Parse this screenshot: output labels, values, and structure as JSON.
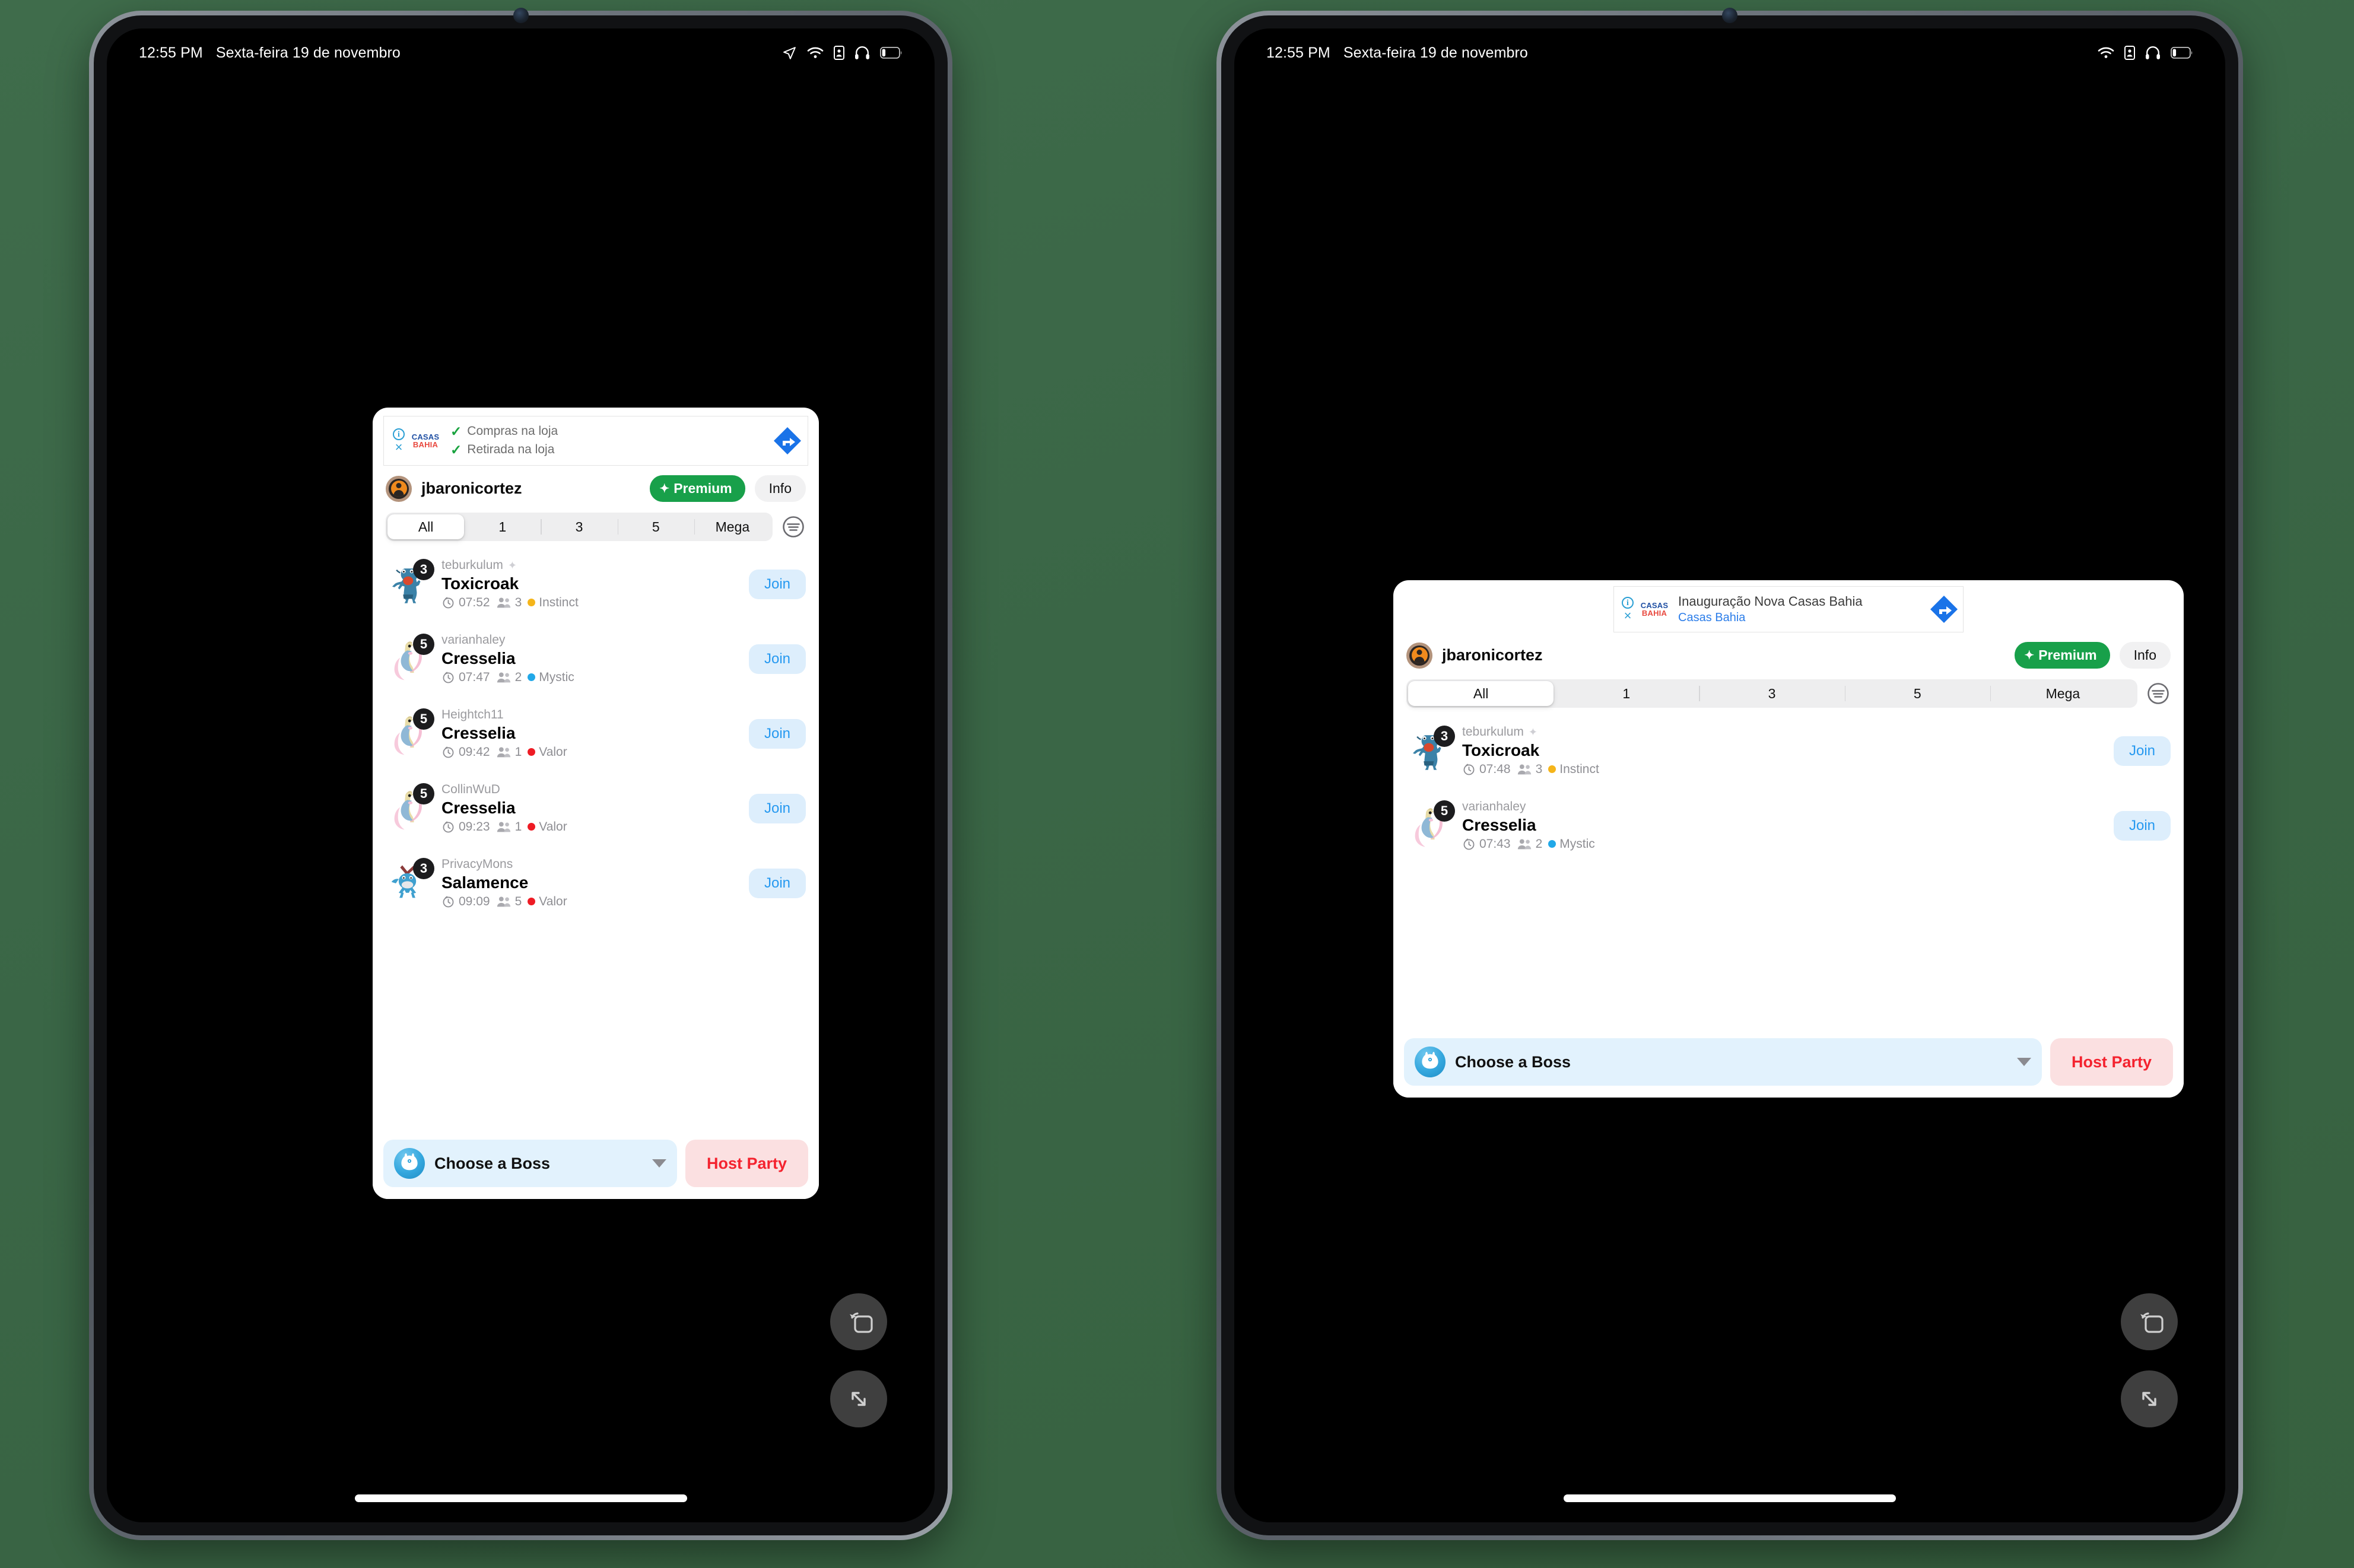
{
  "background_color": "#3e6b4a",
  "status_bar": {
    "time": "12:55 PM",
    "date": "Sexta-feira 19 de novembro",
    "icons_left_device": [
      "location-arrow-icon",
      "wifi-icon",
      "screen-lock-icon",
      "headphones-icon",
      "battery-icon"
    ],
    "icons_right_device": [
      "wifi-icon",
      "screen-lock-icon",
      "headphones-icon",
      "battery-icon"
    ]
  },
  "app": {
    "ad_left": {
      "brand_line1": "CASAS",
      "brand_line2": "BAHIA",
      "bullet1": "Compras na loja",
      "bullet2": "Retirada na loja",
      "info_glyph": "i",
      "close_glyph": "×",
      "arrow_icon": "ad-choices-arrow-icon"
    },
    "ad_right": {
      "brand_line1": "CASAS",
      "brand_line2": "BAHIA",
      "title": "Inauguração Nova Casas Bahia",
      "subtitle": "Casas Bahia",
      "info_glyph": "i",
      "close_glyph": "×",
      "arrow_icon": "ad-choices-arrow-icon"
    },
    "header": {
      "username": "jbaronicortez",
      "premium_label": "Premium",
      "premium_color": "#18a04a",
      "info_label": "Info",
      "avatar_icon": "user-avatar-icon"
    },
    "segments": [
      {
        "label": "All",
        "selected": true
      },
      {
        "label": "1",
        "selected": false
      },
      {
        "label": "3",
        "selected": false
      },
      {
        "label": "5",
        "selected": false
      },
      {
        "label": "Mega",
        "selected": false
      }
    ],
    "filter_icon": "filter-sort-icon",
    "join_label": "Join",
    "rows_left": [
      {
        "host": "teburkulum",
        "shiny": true,
        "boss": "Toxicroak",
        "level": "3",
        "time": "07:52",
        "players": "3",
        "team": "Instinct",
        "team_color": "#f5b51a",
        "sprite": "toxicroak"
      },
      {
        "host": "varianhaley",
        "shiny": false,
        "boss": "Cresselia",
        "level": "5",
        "time": "07:47",
        "players": "2",
        "team": "Mystic",
        "team_color": "#21a8e8",
        "sprite": "cresselia"
      },
      {
        "host": "Heightch11",
        "shiny": false,
        "boss": "Cresselia",
        "level": "5",
        "time": "09:42",
        "players": "1",
        "team": "Valor",
        "team_color": "#ee1b24",
        "sprite": "cresselia"
      },
      {
        "host": "CollinWuD",
        "shiny": false,
        "boss": "Cresselia",
        "level": "5",
        "time": "09:23",
        "players": "1",
        "team": "Valor",
        "team_color": "#ee1b24",
        "sprite": "cresselia"
      },
      {
        "host": "PrivacyMons",
        "shiny": false,
        "boss": "Salamence",
        "level": "3",
        "time": "09:09",
        "players": "5",
        "team": "Valor",
        "team_color": "#ee1b24",
        "sprite": "salamence"
      }
    ],
    "rows_right": [
      {
        "host": "teburkulum",
        "shiny": true,
        "boss": "Toxicroak",
        "level": "3",
        "time": "07:48",
        "players": "3",
        "team": "Instinct",
        "team_color": "#f5b51a",
        "sprite": "toxicroak"
      },
      {
        "host": "varianhaley",
        "shiny": false,
        "boss": "Cresselia",
        "level": "5",
        "time": "07:43",
        "players": "2",
        "team": "Mystic",
        "team_color": "#21a8e8",
        "sprite": "cresselia"
      }
    ],
    "bottom_bar": {
      "choose_label": "Choose a Boss",
      "choose_icon": "pokemon-boss-icon",
      "dropdown_icon": "caret-down-icon",
      "host_label": "Host Party",
      "host_color": "#f4232f"
    }
  },
  "overlay_buttons": {
    "rotate_icon": "rotate-screen-icon",
    "expand_icon": "expand-fullscreen-icon"
  }
}
